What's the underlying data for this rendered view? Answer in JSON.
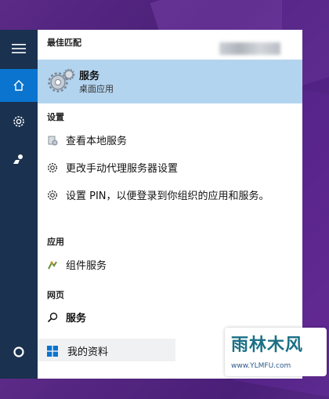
{
  "start_menu": {
    "best_match_header": "最佳匹配",
    "best_match": {
      "title": "服务",
      "subtitle": "桌面应用"
    },
    "settings_header": "设置",
    "settings_items": [
      {
        "label": "查看本地服务",
        "icon": "services-small-icon"
      },
      {
        "label": "更改手动代理服务器设置",
        "icon": "gear-icon"
      },
      {
        "label": "设置 PIN，以便登录到你组织的应用和服务。",
        "icon": "gear-icon"
      }
    ],
    "apps_header": "应用",
    "apps_items": [
      {
        "label": "组件服务",
        "icon": "component-services-icon"
      }
    ],
    "web_header": "网页",
    "web_items": [
      {
        "label": "服务",
        "icon": "search-icon"
      }
    ],
    "my_stuff": {
      "label": "我的资料",
      "icon": "windows-logo-icon"
    }
  },
  "sidebar": {
    "buttons": [
      "hamburger-menu-icon",
      "home-icon",
      "gear-icon",
      "feedback-icon",
      "cortana-circle-icon"
    ],
    "active": "home-icon"
  },
  "watermark": {
    "main": "雨林木风",
    "url": "www.YLMFU.com"
  },
  "colors": {
    "rail": "#1a3150",
    "active": "#0a74cf",
    "highlight": "#b3d4ef"
  }
}
